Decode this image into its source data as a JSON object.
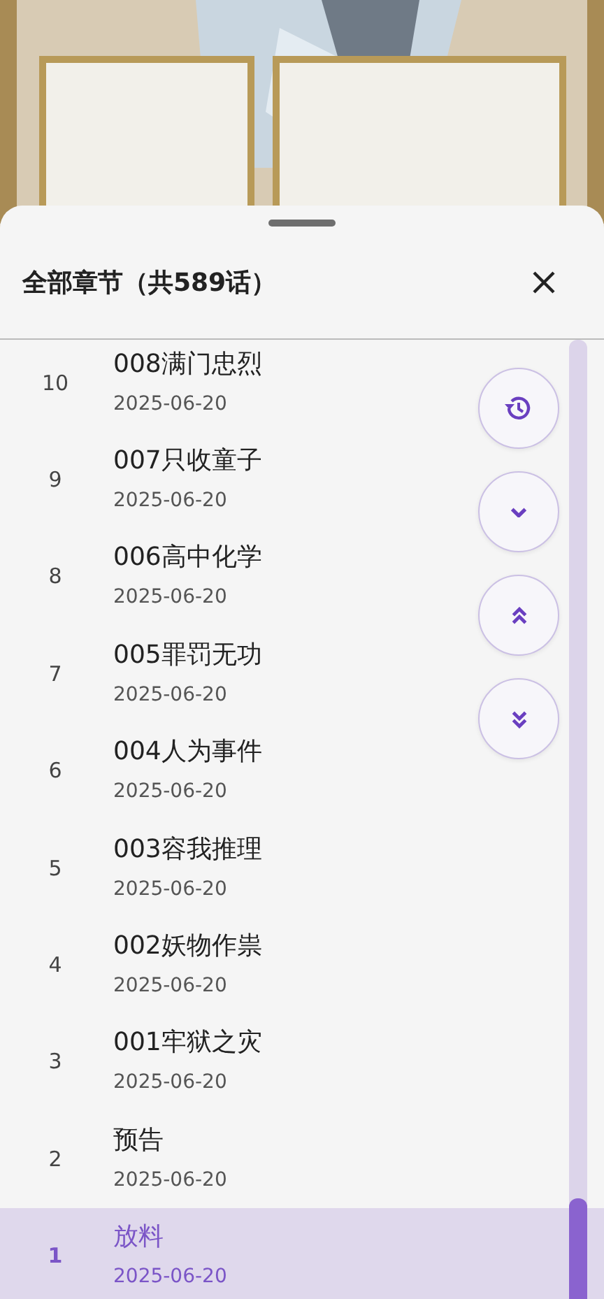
{
  "sheet": {
    "title": "全部章节（共589话）"
  },
  "chapters": [
    {
      "number": "10",
      "title": "008满门忠烈",
      "date": "2025-06-20",
      "selected": false
    },
    {
      "number": "9",
      "title": "007只收童子",
      "date": "2025-06-20",
      "selected": false
    },
    {
      "number": "8",
      "title": "006高中化学",
      "date": "2025-06-20",
      "selected": false
    },
    {
      "number": "7",
      "title": "005罪罚无功",
      "date": "2025-06-20",
      "selected": false
    },
    {
      "number": "6",
      "title": "004人为事件",
      "date": "2025-06-20",
      "selected": false
    },
    {
      "number": "5",
      "title": "003容我推理",
      "date": "2025-06-20",
      "selected": false
    },
    {
      "number": "4",
      "title": "002妖物作祟",
      "date": "2025-06-20",
      "selected": false
    },
    {
      "number": "3",
      "title": "001牢狱之灾",
      "date": "2025-06-20",
      "selected": false
    },
    {
      "number": "2",
      "title": "预告",
      "date": "2025-06-20",
      "selected": false
    },
    {
      "number": "1",
      "title": "放料",
      "date": "2025-06-20",
      "selected": true
    }
  ],
  "fab_buttons": [
    {
      "kind": "history"
    },
    {
      "kind": "down"
    },
    {
      "kind": "top"
    },
    {
      "kind": "bottom"
    }
  ]
}
